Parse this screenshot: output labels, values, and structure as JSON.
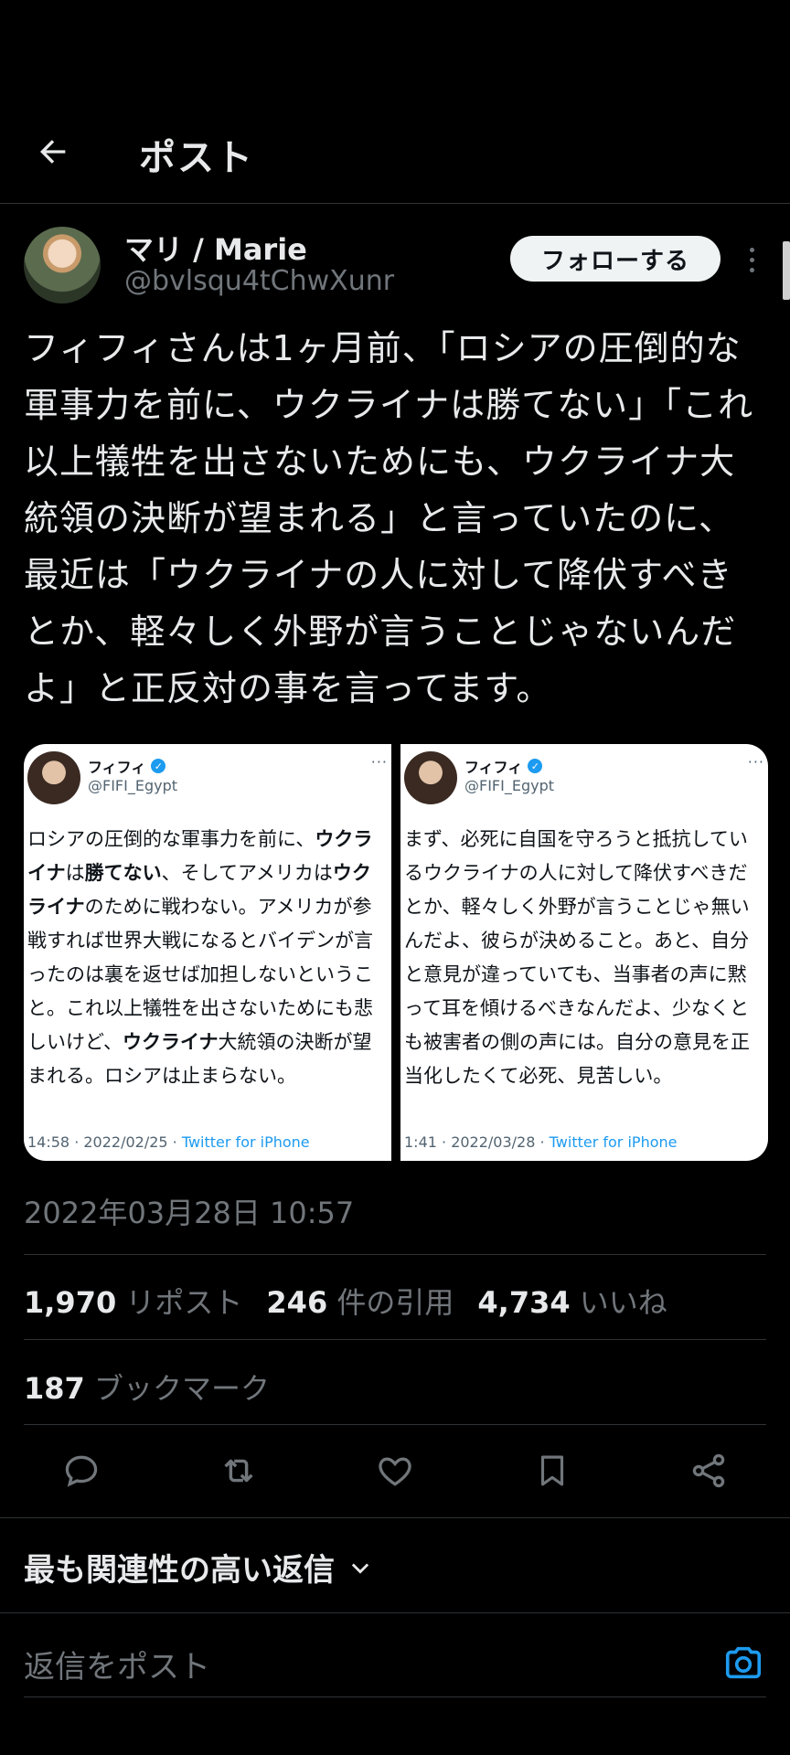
{
  "header": {
    "title": "ポスト"
  },
  "author": {
    "display_name": "マリ / Marie",
    "handle": "@bvlsqu4tChwXunr",
    "follow_label": "フォローする"
  },
  "tweet": {
    "text": "フィフィさんは1ヶ月前、「ロシアの圧倒的な軍事力を前に、ウクライナは勝てない」「これ以上犠牲を出さないためにも、ウクライナ大統領の決断が望まれる」と言っていたのに、最近は「ウクライナの人に対して降伏すべきとか、軽々しく外野が言うことじゃないんだよ」と正反対の事を言ってます。",
    "timestamp": "2022年03月28日 10:57"
  },
  "media": [
    {
      "name": "フィフィ",
      "handle": "@FIFI_Egypt",
      "more": "···",
      "body_parts": [
        "ロシアの圧倒的な軍事力を前に、",
        "ウクライナ",
        "は",
        "勝てない",
        "、そしてアメリカは",
        "ウクライナ",
        "のために戦わない。アメリカが参戦すれば世界大戦になるとバイデンが言ったのは裏を返せば加担しないということ。これ以上犠牲を出さないためにも悲しいけど、",
        "ウクライナ",
        "大統領の決断が望まれる。ロシアは止まらない。"
      ],
      "time": "14:58 · 2022/02/25 · ",
      "source": "Twitter for iPhone"
    },
    {
      "name": "フィフィ",
      "handle": "@FIFI_Egypt",
      "more": "···",
      "body": "まず、必死に自国を守ろうと抵抗しているウクライナの人に対して降伏すべきだとか、軽々しく外野が言うことじゃ無いんだよ、彼らが決めること。あと、自分と意見が違っていても、当事者の声に黙って耳を傾けるべきなんだよ、少なくとも被害者の側の声には。自分の意見を正当化したくて必死、見苦しい。",
      "time": "1:41 · 2022/03/28 · ",
      "source": "Twitter for iPhone"
    }
  ],
  "stats": {
    "reposts_num": "1,970",
    "reposts_label": "リポスト",
    "quotes_num": "246",
    "quotes_label": "件の引用",
    "likes_num": "4,734",
    "likes_label": "いいね",
    "bookmarks_num": "187",
    "bookmarks_label": "ブックマーク"
  },
  "replies": {
    "sort_label": "最も関連性の高い返信",
    "input_placeholder": "返信をポスト"
  },
  "colors": {
    "background": "#000000",
    "accent": "#1d9bf0",
    "muted": "#71767b",
    "divider": "#2f3336"
  }
}
